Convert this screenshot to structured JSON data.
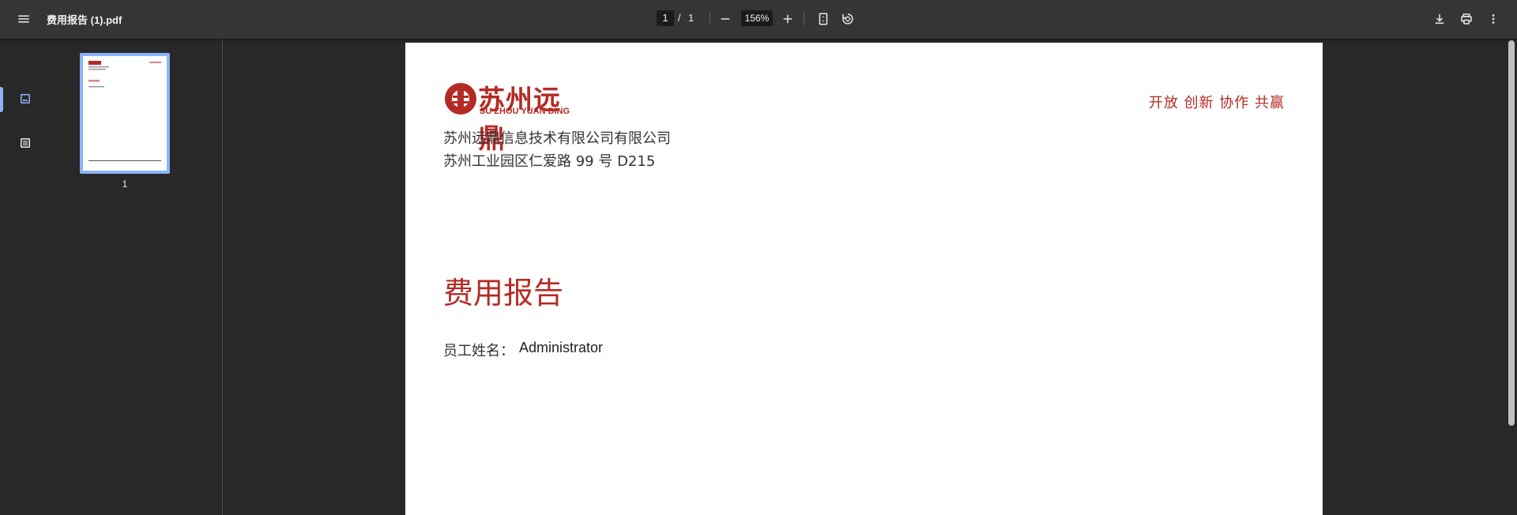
{
  "toolbar": {
    "file_name": "费用报告 (1).pdf",
    "current_page": "1",
    "page_separator": "/",
    "total_pages": "1",
    "zoom": "156%"
  },
  "thumbnails": [
    {
      "page_label": "1"
    }
  ],
  "document": {
    "logo_cn": "苏州远鼎",
    "logo_en": "SU ZHOU YUAN DING",
    "slogan": "开放 创新 协作 共赢",
    "company": "苏州远鼎信息技术有限公司有限公司",
    "address": "苏州工业园区仁爱路 99 号 D215",
    "title": "费用报告",
    "employee_label": "员工姓名：",
    "employee_name": "Administrator"
  },
  "colors": {
    "accent": "#8ab4f8",
    "brand_red": "#b42b25",
    "toolbar_bg": "#333536",
    "viewer_bg": "#282828"
  }
}
